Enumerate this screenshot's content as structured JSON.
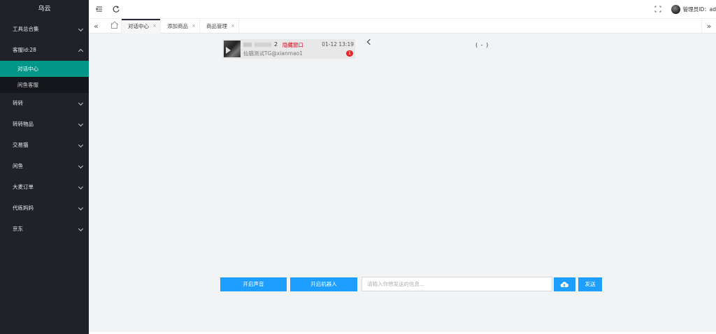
{
  "sidebar": {
    "logo": "乌云",
    "menu": [
      {
        "label": "工具总合集",
        "expanded": false
      },
      {
        "label": "客服id:28",
        "expanded": true
      },
      {
        "label": "转转",
        "expanded": false
      },
      {
        "label": "转转物品",
        "expanded": false
      },
      {
        "label": "交易猫",
        "expanded": false
      },
      {
        "label": "闲鱼",
        "expanded": false
      },
      {
        "label": "大麦订单",
        "expanded": false
      },
      {
        "label": "代练妈妈",
        "expanded": false
      },
      {
        "label": "京东",
        "expanded": false
      }
    ],
    "submenu": [
      {
        "label": "对话中心",
        "active": true
      },
      {
        "label": "闲鱼客服",
        "active": false
      }
    ]
  },
  "header": {
    "admin_label": "管理员ID：ad"
  },
  "tabs": [
    {
      "label": "对话中心",
      "active": true,
      "close": "×"
    },
    {
      "label": "添加商品",
      "active": false,
      "close": "×"
    },
    {
      "label": "商品管理",
      "active": false,
      "close": "×"
    }
  ],
  "chat_list": [
    {
      "number": "2",
      "hide_label": "隐藏窗口",
      "subtitle": "仙猫测试TG@xianmao1",
      "time": "01-12 13:19",
      "unread": "1"
    }
  ],
  "conversation": {
    "title": "( - )"
  },
  "controls": {
    "sound_button": "开启声音",
    "robot_button": "开启机器人",
    "input_placeholder": "请输入你想发送的信息...",
    "send_button": "发送"
  },
  "colors": {
    "sidebar_bg": "#20222a",
    "active_menu": "#009688",
    "primary_button": "#1e9fff",
    "hide_link": "#d9001b",
    "badge": "#e6232b"
  }
}
